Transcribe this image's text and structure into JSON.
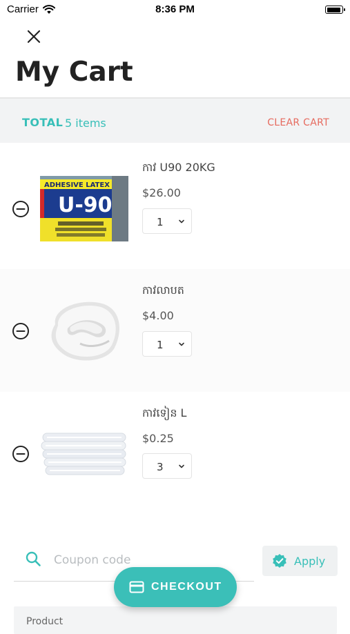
{
  "status_bar": {
    "carrier": "Carrier",
    "time": "8:36 PM",
    "battery_level": 0.95
  },
  "header": {
    "title": "My Cart"
  },
  "summary": {
    "total_label": "TOTAL",
    "item_count": "5 items",
    "clear_label": "CLEAR CART"
  },
  "items": [
    {
      "name": "កាវ U90 20KG",
      "price": "$26.00",
      "qty": "1",
      "image": "adhesive-bucket-image",
      "image_text": "ADHESIVE LATEX U-90"
    },
    {
      "name": "កាវលាបត",
      "price": "$4.00",
      "qty": "1",
      "image": "white-paste-image"
    },
    {
      "name": "កាវទៀន L",
      "price": "$0.25",
      "qty": "3",
      "image": "glue-sticks-image"
    }
  ],
  "coupon": {
    "placeholder": "Coupon code",
    "apply_label": "Apply"
  },
  "summary_box": {
    "text": "Product"
  },
  "checkout": {
    "label": "CHECKOUT"
  },
  "colors": {
    "accent": "#3bbfb8",
    "danger": "#e66a5e",
    "title": "#222222"
  }
}
